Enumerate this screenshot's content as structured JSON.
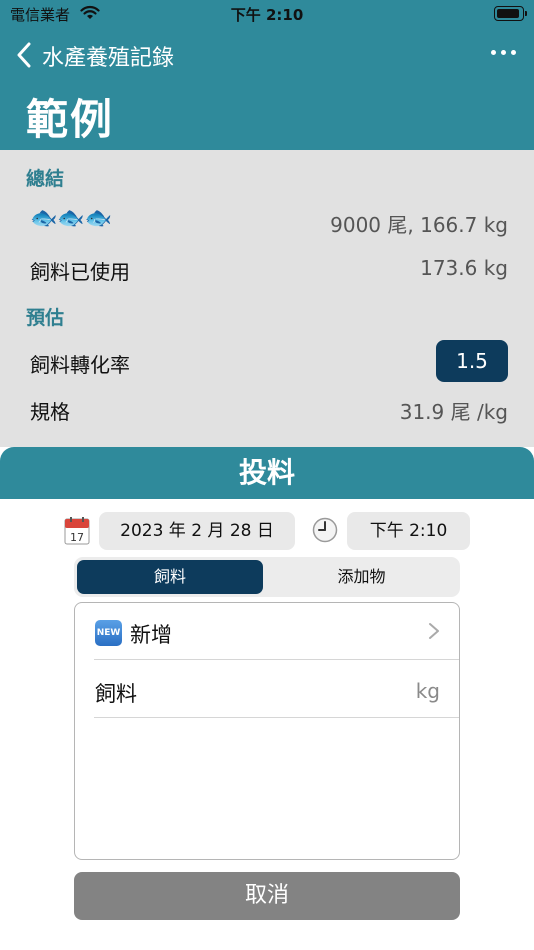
{
  "status_bar": {
    "carrier": "電信業者",
    "time": "下午 2:10"
  },
  "nav": {
    "back_label": "水產養殖記錄",
    "page_title": "範例"
  },
  "summary": {
    "section_label": "總結",
    "fish_icons": "🐟🐟🐟",
    "stock_value": "9000 尾, 166.7 kg",
    "feed_used_label": "飼料已使用",
    "feed_used_value": "173.6 kg"
  },
  "estimate": {
    "section_label": "預估",
    "fcr_label": "飼料轉化率",
    "fcr_value": "1.5",
    "size_label": "規格",
    "size_value": "31.9 尾 /kg"
  },
  "feeding": {
    "title": "投料",
    "calendar_day": "17",
    "date": "2023 年 2 月 28 日",
    "time": "下午 2:10",
    "tabs": [
      {
        "label": "飼料",
        "selected": true
      },
      {
        "label": "添加物",
        "selected": false
      }
    ],
    "new_badge": "NEW",
    "add_label": "新增",
    "feed_item_label": "飼料",
    "feed_item_unit": "kg",
    "cancel_label": "取消"
  },
  "colors": {
    "header_teal": "#2f8a9b",
    "navy": "#0d3b5c",
    "summary_grey": "#e1e1e1",
    "cancel_grey": "#838383"
  }
}
